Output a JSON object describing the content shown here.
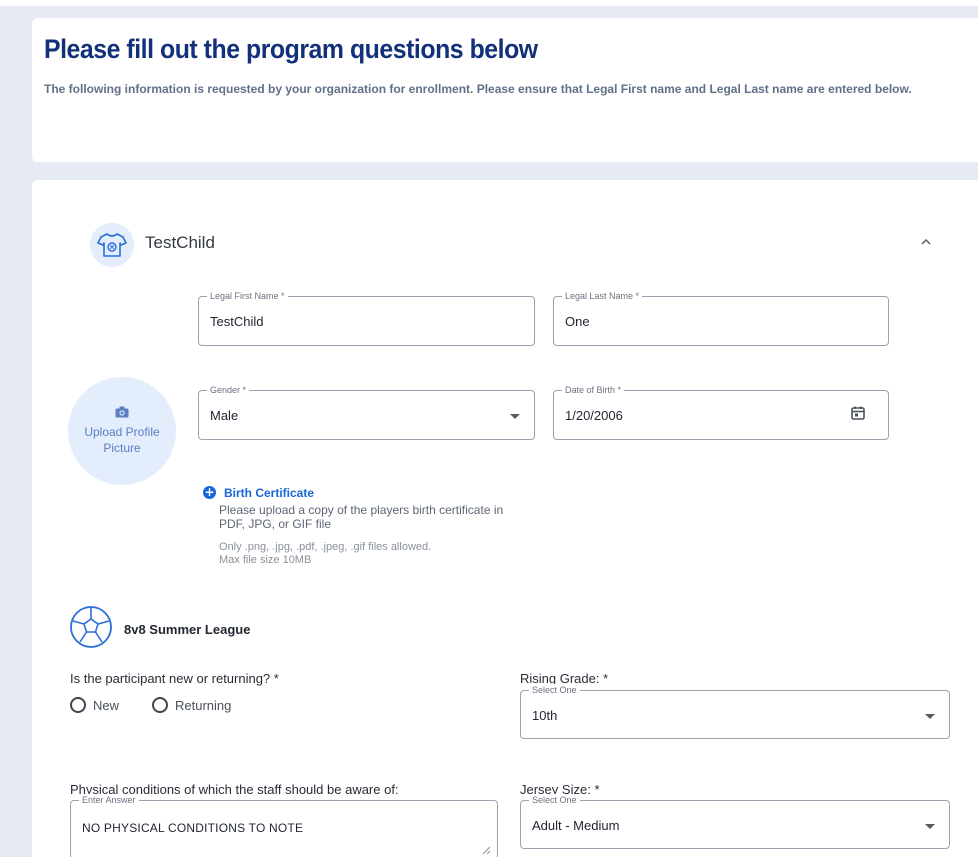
{
  "header": {
    "title": "Please fill out the program questions below",
    "description": "The following information is requested by your organization for enrollment. Please ensure that Legal First name and Legal Last name are entered below."
  },
  "child": {
    "name": "TestChild",
    "avatar_icon": "jersey-icon",
    "collapse_icon": "chevron-up-icon"
  },
  "fields": {
    "first_name": {
      "label": "Legal First Name *",
      "value": "TestChild"
    },
    "last_name": {
      "label": "Legal Last Name *",
      "value": "One"
    },
    "gender": {
      "label": "Gender *",
      "value": "Male"
    },
    "dob": {
      "label": "Date of Birth *",
      "value": "1/20/2006"
    }
  },
  "upload": {
    "icon": "camera-icon",
    "label": "Upload Profile Picture"
  },
  "birth_certificate": {
    "title": "Birth Certificate",
    "description": "Please upload a copy of the players birth certificate in PDF, JPG, or GIF file",
    "allowed": "Only .png, .jpg, .pdf, .jpeg, .gif files allowed.",
    "max_size": "Max file size 10MB"
  },
  "program": {
    "icon": "soccer-ball-icon",
    "title": "8v8 Summer League"
  },
  "questions": {
    "new_returning": {
      "label": "Is the participant new or returning?",
      "required_mark": "*",
      "options": [
        "New",
        "Returning"
      ]
    },
    "rising_grade": {
      "label": "Rising Grade:",
      "required_mark": "*",
      "sublabel": "Select One",
      "value": "10th"
    },
    "physical_conditions": {
      "label": "Physical conditions of which the staff should be aware of:",
      "sublabel": "Enter Answer",
      "value": "NO PHYSICAL CONDITIONS TO NOTE"
    },
    "jersey_size": {
      "label": "Jersey Size:",
      "required_mark": "*",
      "sublabel": "Select One",
      "value": "Adult - Medium"
    }
  },
  "colors": {
    "title_navy": "#13317a",
    "link_blue": "#1866d8",
    "page_bg": "#e6ebf3",
    "avatar_bg": "#e3edfb"
  }
}
